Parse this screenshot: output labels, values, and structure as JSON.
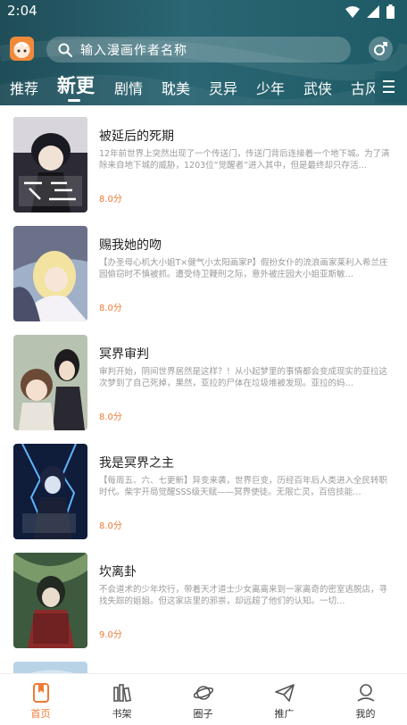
{
  "status_bar": {
    "time": "2:04"
  },
  "search": {
    "placeholder": "输入漫画作者名称"
  },
  "tabs": [
    {
      "label": "推荐"
    },
    {
      "label": "新更"
    },
    {
      "label": "剧情"
    },
    {
      "label": "耽美"
    },
    {
      "label": "灵异"
    },
    {
      "label": "少年"
    },
    {
      "label": "武侠"
    },
    {
      "label": "古风"
    }
  ],
  "active_tab": "新更",
  "comics": [
    {
      "title": "被延后的死期",
      "desc": "12年前世界上突然出现了一个传送门，传送门背后连接着一个地下城。为了清除来自地下城的威胁，1203位“觉醒者”进入其中，但是最终却只存活…",
      "score": "8.0分"
    },
    {
      "title": "赐我她的吻",
      "desc": "【办圣母心机大小姐T×健气小太阳画家P】假扮女仆的流浪画家莱利入希兰庄园偷窃时不慎被抓。遭受侍卫鞭刑之际，意外被庄园大小姐亚斯敏…",
      "score": "8.0分"
    },
    {
      "title": "冥界审判",
      "desc": "审判开始，阴间世界居然是这样？！从小起梦里的事情都会变成现实的亚拉这次梦到了自己死掉，果然，亚拉的尸体在垃圾堆被发现。亚拉的妈…",
      "score": "8.0分"
    },
    {
      "title": "我是冥界之主",
      "desc": "【每周五、六、七更新】异变来袭，世界巨变，历经百年后人类进入全民转职时代。柴宇开局觉醒SSS级天赋——冥界使徒。无限亡灵，百倍技能…",
      "score": "8.0分"
    },
    {
      "title": "坎离卦",
      "desc": "不会道术的少年坎行，带着天才道士少女离离来到一家离奇的密室逃脱店，寻找失踪的姐姐。但这家店里的邪祟，却远超了他们的认知。一切…",
      "score": "9.0分"
    }
  ],
  "bottom_nav": [
    {
      "label": "首页",
      "icon": "bookmark-icon"
    },
    {
      "label": "书架",
      "icon": "bookshelf-icon"
    },
    {
      "label": "圈子",
      "icon": "planet-icon"
    },
    {
      "label": "推广",
      "icon": "paper-plane-icon"
    },
    {
      "label": "我的",
      "icon": "user-icon"
    }
  ],
  "colors": {
    "header": "#1f5b66",
    "accent": "#f07a36"
  }
}
